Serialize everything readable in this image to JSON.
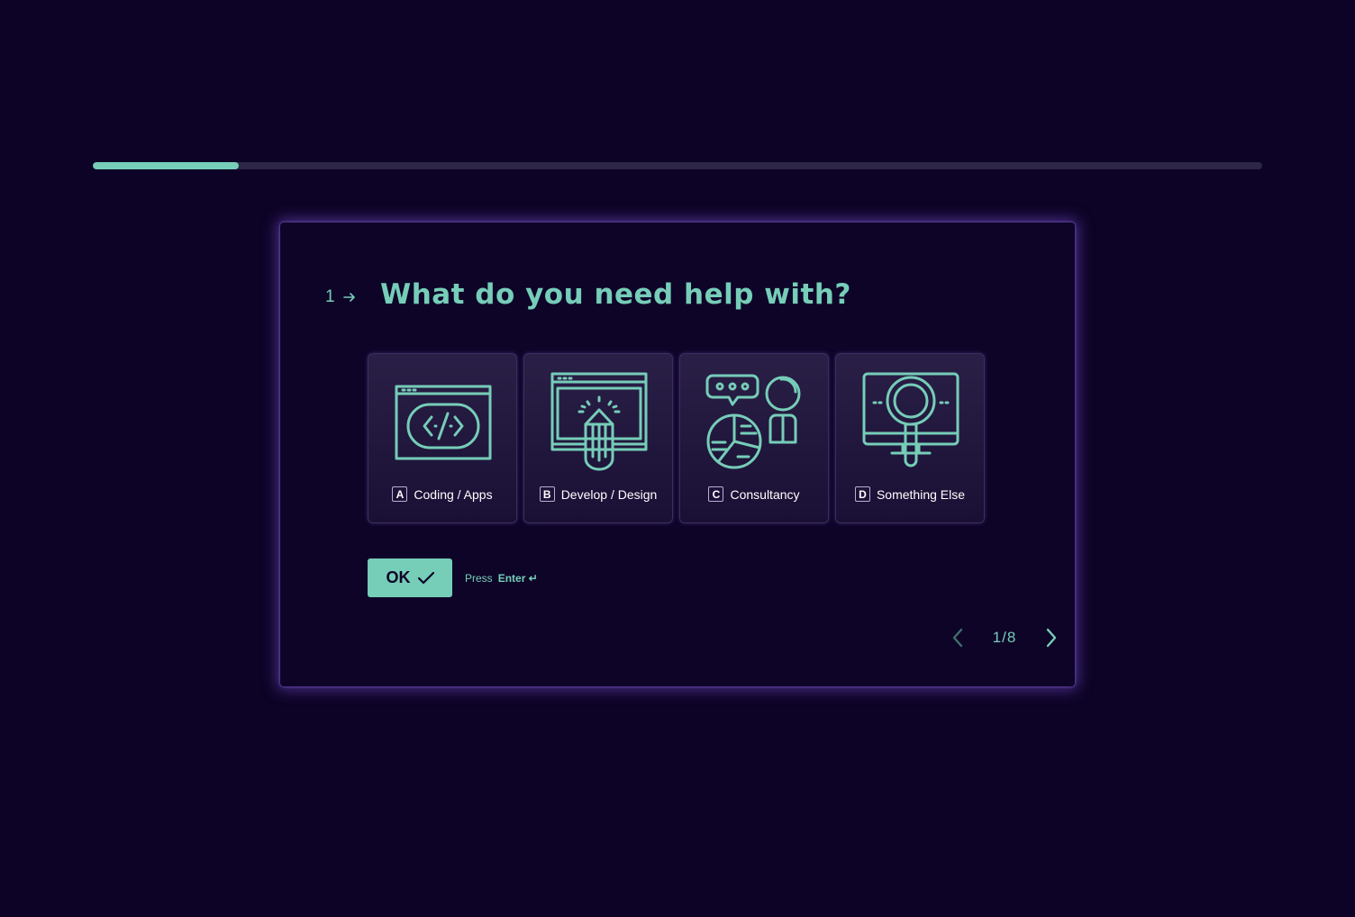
{
  "progress": {
    "fraction": 0.125
  },
  "question": {
    "number": "1",
    "title": "What do you need help with?"
  },
  "options": [
    {
      "key": "A",
      "label": "Coding / Apps",
      "icon": "code-window-icon"
    },
    {
      "key": "B",
      "label": "Develop / Design",
      "icon": "design-pencil-icon"
    },
    {
      "key": "C",
      "label": "Consultancy",
      "icon": "consultancy-chat-chart-icon"
    },
    {
      "key": "D",
      "label": "Something Else",
      "icon": "magnifier-monitor-icon"
    }
  ],
  "ok_button": {
    "label": "OK"
  },
  "hint": {
    "press": "Press",
    "enter": "Enter ↵"
  },
  "pager": {
    "text": "1/8"
  },
  "colors": {
    "background": "#0d0326",
    "accent": "#76cdb8",
    "card": "#221839"
  }
}
